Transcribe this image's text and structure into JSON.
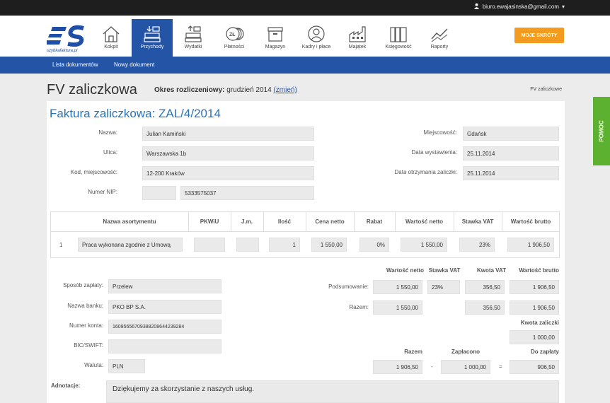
{
  "user": {
    "email": "biuro.ewajasinska@gmail.com"
  },
  "brand": {
    "logo_text": "szybkafaktura.pl"
  },
  "nav": {
    "items": [
      "Kokpit",
      "Przychody",
      "Wydatki",
      "Płatności",
      "Magazyn",
      "Kadry i płace",
      "Majątek",
      "Księgowość",
      "Raporty"
    ],
    "shortcuts": "MOJE SKRÓTY"
  },
  "subnav": {
    "items": [
      "Lista dokumentów",
      "Nowy dokument"
    ]
  },
  "page": {
    "title": "FV zaliczkowa",
    "period_label": "Okres rozliczeniowy:",
    "period_value": "grudzień 2014",
    "period_link": "(zmień)",
    "crumb": "FV zaliczkowe",
    "doc_title": "Faktura zaliczkowa: ZAL/4/2014"
  },
  "form": {
    "name_label": "Nazwa:",
    "name": "Julian Kamiński",
    "street_label": "Ulica:",
    "street": "Warszawska 1b",
    "city_label": "Kod, miejscowość:",
    "city": "12-200 Kraków",
    "nip_label": "Numer NIP:",
    "nip_prefix": "",
    "nip": "5333575037",
    "place_label": "Miejscowość:",
    "place": "Gdańsk",
    "issue_label": "Data wystawienia:",
    "issue": "25.11.2014",
    "received_label": "Data otrzymania zaliczki:",
    "received": "25.11.2014"
  },
  "items_table": {
    "headers": [
      "Nazwa asortymentu",
      "PKWiU",
      "J.m.",
      "Ilość",
      "Cena netto",
      "Rabat",
      "Wartość netto",
      "Stawka VAT",
      "Wartość brutto"
    ],
    "row": {
      "no": "1",
      "name": "Praca wykonana zgodnie z Umową",
      "pkwiu": "",
      "unit": "",
      "qty": "1",
      "price": "1 550,00",
      "discount": "0%",
      "net": "1 550,00",
      "vat": "23%",
      "gross": "1 906,50"
    }
  },
  "payment": {
    "method_label": "Sposób zapłaty:",
    "method": "Przelew",
    "bank_label": "Nazwa banku:",
    "bank": "PKO BP S.A.",
    "account_label": "Numer konta:",
    "account": "16095656709388208644239284",
    "swift_label": "BIC/SWIFT:",
    "swift": "",
    "currency_label": "Waluta:",
    "currency": "PLN"
  },
  "summary": {
    "headers": [
      "Wartość netto",
      "Stawka VAT",
      "Kwota VAT",
      "Wartość brutto"
    ],
    "summary_label": "Podsumowanie:",
    "summary_row": {
      "net": "1 550,00",
      "vat": "23%",
      "vat_amount": "356,50",
      "gross": "1 906,50"
    },
    "total_label": "Razem:",
    "total_row": {
      "net": "1 550,00",
      "vat_amount": "356,50",
      "gross": "1 906,50"
    },
    "advance_label": "Kwota zaliczki",
    "advance": "1 000,00",
    "final_headers": [
      "Razem",
      "Zapłacono",
      "Do zapłaty"
    ],
    "final_total": "1 906,50",
    "minus": "-",
    "paid": "1 000,00",
    "equals": "=",
    "due": "906,50"
  },
  "notes": {
    "label": "Adnotacje:",
    "text": "Dziękujemy za skorzystanie z naszych usług."
  },
  "help": {
    "label": "POMOC"
  }
}
